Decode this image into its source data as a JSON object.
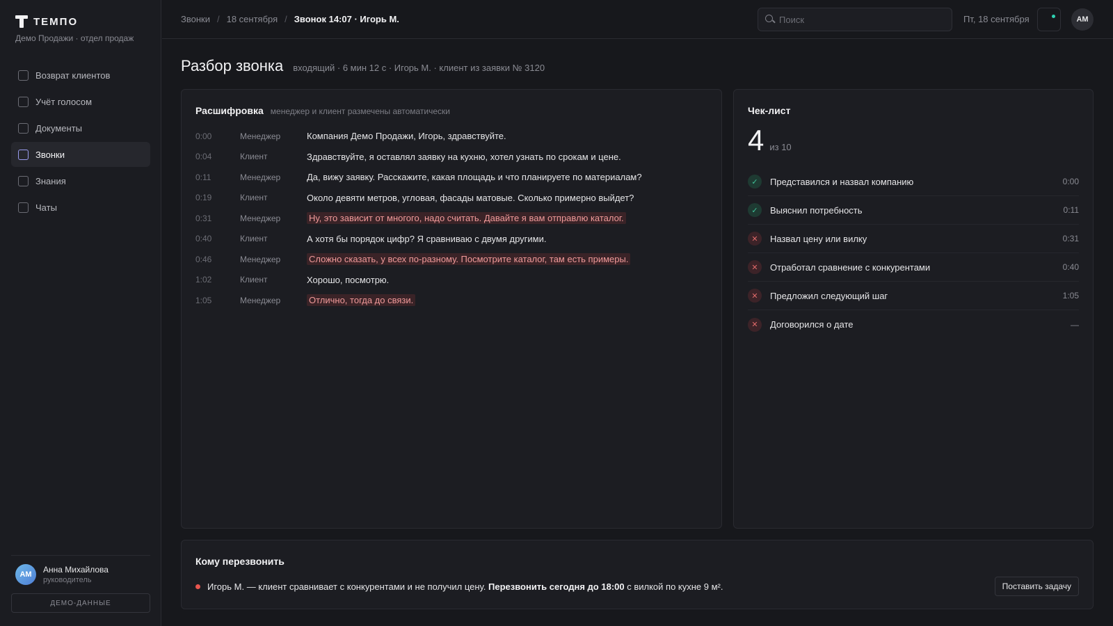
{
  "brand": {
    "name": "ТЕМПО",
    "subtitle": "Демо Продажи · отдел продаж"
  },
  "nav": [
    {
      "label": "Возврат клиентов"
    },
    {
      "label": "Учёт голосом"
    },
    {
      "label": "Документы"
    },
    {
      "label": "Звонки"
    },
    {
      "label": "Знания"
    },
    {
      "label": "Чаты"
    }
  ],
  "user": {
    "initials": "АМ",
    "name": "Анна Михайлова",
    "role": "руководитель"
  },
  "demo_label": "ДЕМО-ДАННЫЕ",
  "breadcrumbs": {
    "root": "Звонки",
    "date": "18 сентября",
    "current": "Звонок 14:07 · Игорь М."
  },
  "search": {
    "placeholder": "Поиск"
  },
  "topbar_date": "Пт, 18 сентября",
  "top_avatar": "АМ",
  "page": {
    "title": "Разбор звонка",
    "meta": "входящий · 6 мин 12 с · Игорь М. · клиент из заявки № 3120"
  },
  "transcript": {
    "title": "Расшифровка",
    "subtitle": "менеджер и клиент размечены автоматически",
    "rows": [
      {
        "time": "0:00",
        "role": "Менеджер",
        "text": "Компания Демо Продажи, Игорь, здравствуйте."
      },
      {
        "time": "0:04",
        "role": "Клиент",
        "text": "Здравствуйте, я оставлял заявку на кухню, хотел узнать по срокам и цене."
      },
      {
        "time": "0:11",
        "role": "Менеджер",
        "text": "Да, вижу заявку. Расскажите, какая площадь и что планируете по материалам?"
      },
      {
        "time": "0:19",
        "role": "Клиент",
        "text": "Около девяти метров, угловая, фасады матовые. Сколько примерно выйдет?"
      },
      {
        "time": "0:31",
        "role": "Менеджер",
        "text": "Ну, это зависит от многого, надо считать. Давайте я вам отправлю каталог."
      },
      {
        "time": "0:40",
        "role": "Клиент",
        "text": "А хотя бы порядок цифр? Я сравниваю с двумя другими."
      },
      {
        "time": "0:46",
        "role": "Менеджер",
        "text": "Сложно сказать, у всех по-разному. Посмотрите каталог, там есть примеры."
      },
      {
        "time": "1:02",
        "role": "Клиент",
        "text": "Хорошо, посмотрю."
      },
      {
        "time": "1:05",
        "role": "Менеджер",
        "text": "Отлично, тогда до связи."
      }
    ]
  },
  "checklist": {
    "title": "Чек-лист",
    "score": "4",
    "score_of": "из 10",
    "items": [
      {
        "label": "Представился и назвал компанию",
        "time": "0:00",
        "status": "ok"
      },
      {
        "label": "Выяснил потребность",
        "time": "0:11",
        "status": "ok"
      },
      {
        "label": "Назвал цену или вилку",
        "time": "0:31",
        "status": "bad"
      },
      {
        "label": "Отработал сравнение с конкурентами",
        "time": "0:40",
        "status": "bad"
      },
      {
        "label": "Предложил следующий шаг",
        "time": "1:05",
        "status": "bad"
      },
      {
        "label": "Договорился о дате",
        "time": "—",
        "status": "bad"
      }
    ]
  },
  "callback": {
    "title": "Кому перезвонить",
    "text_before": "Игорь М. — клиент сравнивает с конкурентами и не получил цену.",
    "text_bold": "Перезвонить сегодня до 18:00",
    "text_after": "с вилкой по кухне 9 м².",
    "button": "Поставить задачу"
  },
  "colors": {
    "flag_bg": "#3a2327",
    "flag_text": "#f09a9a",
    "ok": "#41c49a",
    "bad": "#e06a6a",
    "accent_dot": "#2ed2b2",
    "alert_dot": "#e8564f"
  }
}
